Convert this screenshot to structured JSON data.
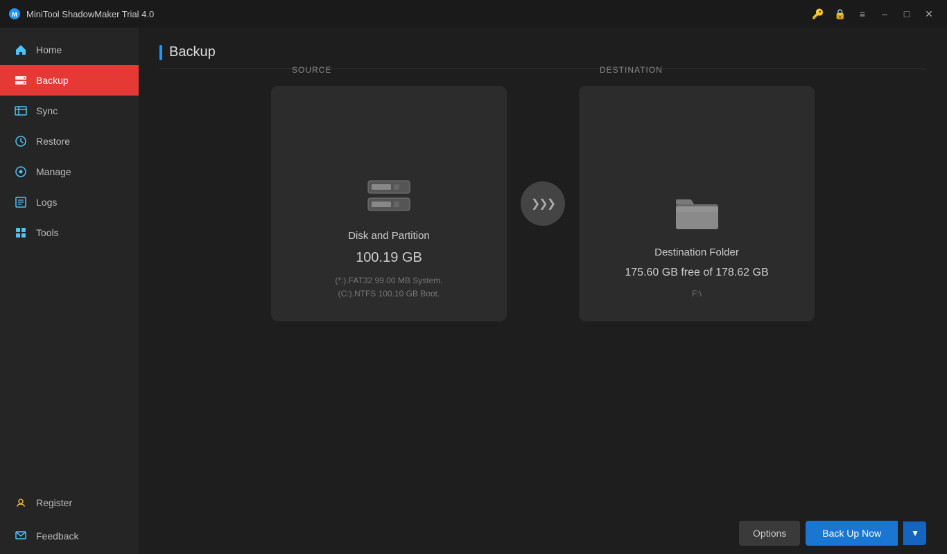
{
  "app": {
    "title": "MiniTool ShadowMaker Trial 4.0"
  },
  "titlebar": {
    "minimize_label": "–",
    "maximize_label": "□",
    "close_label": "✕",
    "menu_label": "☰",
    "key_icon": "🔑",
    "lock_icon": "🔒"
  },
  "sidebar": {
    "items": [
      {
        "id": "home",
        "label": "Home",
        "active": false
      },
      {
        "id": "backup",
        "label": "Backup",
        "active": true
      },
      {
        "id": "sync",
        "label": "Sync",
        "active": false
      },
      {
        "id": "restore",
        "label": "Restore",
        "active": false
      },
      {
        "id": "manage",
        "label": "Manage",
        "active": false
      },
      {
        "id": "logs",
        "label": "Logs",
        "active": false
      },
      {
        "id": "tools",
        "label": "Tools",
        "active": false
      }
    ],
    "bottom_items": [
      {
        "id": "register",
        "label": "Register"
      },
      {
        "id": "feedback",
        "label": "Feedback"
      }
    ]
  },
  "page": {
    "title": "Backup"
  },
  "source_card": {
    "label": "SOURCE",
    "title": "Disk and Partition",
    "size": "100.19 GB",
    "detail_line1": "(*:).FAT32 99.00 MB System.",
    "detail_line2": "(C:).NTFS 100.10 GB Boot."
  },
  "destination_card": {
    "label": "DESTINATION",
    "title": "Destination Folder",
    "free_space": "175.60 GB free of 178.62 GB",
    "path": "F:\\"
  },
  "buttons": {
    "options": "Options",
    "backup_now": "Back Up Now",
    "dropdown_arrow": "▼"
  },
  "arrow": {
    "symbol": "›››"
  }
}
